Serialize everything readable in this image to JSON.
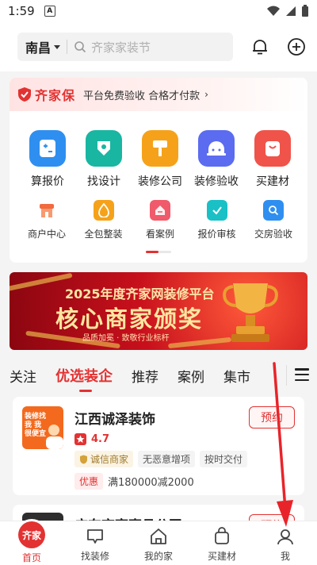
{
  "status_bar": {
    "time": "1:59",
    "notification_badge": "A"
  },
  "header": {
    "city": "南昌",
    "search_placeholder": "齐家家装节",
    "icons": [
      "bell-icon",
      "add-circle-icon"
    ]
  },
  "guarantee": {
    "brand": "齐家保",
    "text": "平台免费验收 合格才付款",
    "arrow": "›"
  },
  "services_primary": [
    {
      "label": "算报价",
      "icon": "calculator-icon",
      "color": "#2f8ff0"
    },
    {
      "label": "找设计",
      "icon": "design-icon",
      "color": "#19b6a2"
    },
    {
      "label": "装修公司",
      "icon": "paint-roller-icon",
      "color": "#f5a21a"
    },
    {
      "label": "装修验收",
      "icon": "helmet-icon",
      "color": "#5b6cf0"
    },
    {
      "label": "买建材",
      "icon": "shopping-bag-icon",
      "color": "#f0534a"
    }
  ],
  "services_secondary": [
    {
      "label": "商户中心",
      "icon": "store-icon",
      "color": "#f26a3d"
    },
    {
      "label": "全包整装",
      "icon": "flame-icon",
      "color": "#f5a21a"
    },
    {
      "label": "看案例",
      "icon": "case-icon",
      "color": "#f05a6a"
    },
    {
      "label": "报价审核",
      "icon": "check-icon",
      "color": "#19c0c6"
    },
    {
      "label": "交房验收",
      "icon": "search-house-icon",
      "color": "#2f8ff0"
    }
  ],
  "promo_banner": {
    "title1": "2025年度齐家网装修平台",
    "title2": "核心商家颁奖",
    "subtitle": "品质加冕 · 致敬行业标杆"
  },
  "tabs": [
    "关注",
    "优选装企",
    "推荐",
    "案例",
    "集市"
  ],
  "active_tab": "优选装企",
  "company": {
    "name": "江西诚泽装饰",
    "appoint_label": "预约",
    "rating": "4.7",
    "tags": [
      "诚信商家",
      "无恶意增项",
      "按时交付"
    ],
    "promo_badge": "优惠",
    "promo_text": "满180000减2000",
    "logo_text": "装修找我 我很便宜"
  },
  "company2": {
    "name": "广东齐享声具公司",
    "appoint_label": "预约"
  },
  "bottom_nav": [
    {
      "label": "首页",
      "icon": "home-icon",
      "badge": "齐家"
    },
    {
      "label": "找装修",
      "icon": "chat-icon"
    },
    {
      "label": "我的家",
      "icon": "house-icon"
    },
    {
      "label": "买建材",
      "icon": "bag-icon"
    },
    {
      "label": "我",
      "icon": "user-icon"
    }
  ],
  "colors": {
    "accent": "#e33232",
    "background": "#f4f4f4"
  }
}
